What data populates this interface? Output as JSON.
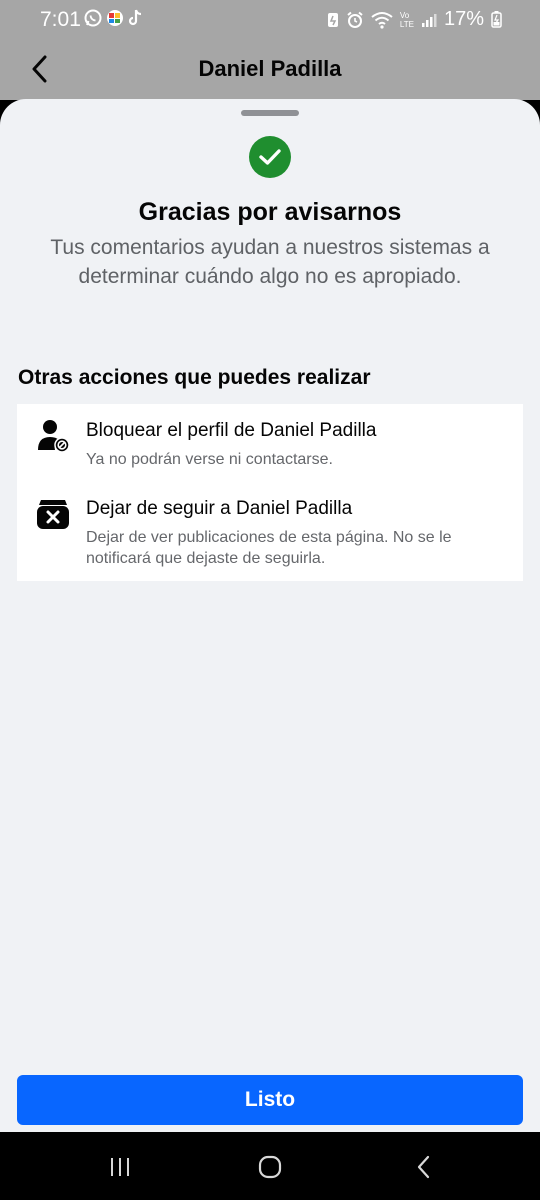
{
  "status_bar": {
    "time": "7:01",
    "battery_percent": "17%",
    "network_label_top": "Vo",
    "network_label_bottom": "LTE"
  },
  "header": {
    "title": "Daniel Padilla",
    "back_icon": "chevron-left-icon"
  },
  "sheet": {
    "badge_icon": "checkmark-icon",
    "title": "Gracias por avisarnos",
    "description": "Tus comentarios ayudan a nuestros sistemas a determinar cuándo algo no es apropiado.",
    "section_title": "Otras acciones que puedes realizar",
    "actions": [
      {
        "icon": "block-user-icon",
        "title": "Bloquear el perfil de Daniel Padilla",
        "subtitle": "Ya no podrán verse ni contactarse."
      },
      {
        "icon": "unfollow-icon",
        "title": "Dejar de seguir a Daniel Padilla",
        "subtitle": "Dejar de ver publicaciones de esta página. No se le notificará que dejaste de seguirla."
      }
    ],
    "done_label": "Listo"
  },
  "colors": {
    "accent": "#0866ff",
    "success": "#1f8e2f",
    "sheet_background": "#f0f2f5",
    "header_background": "#a6a6a6"
  }
}
